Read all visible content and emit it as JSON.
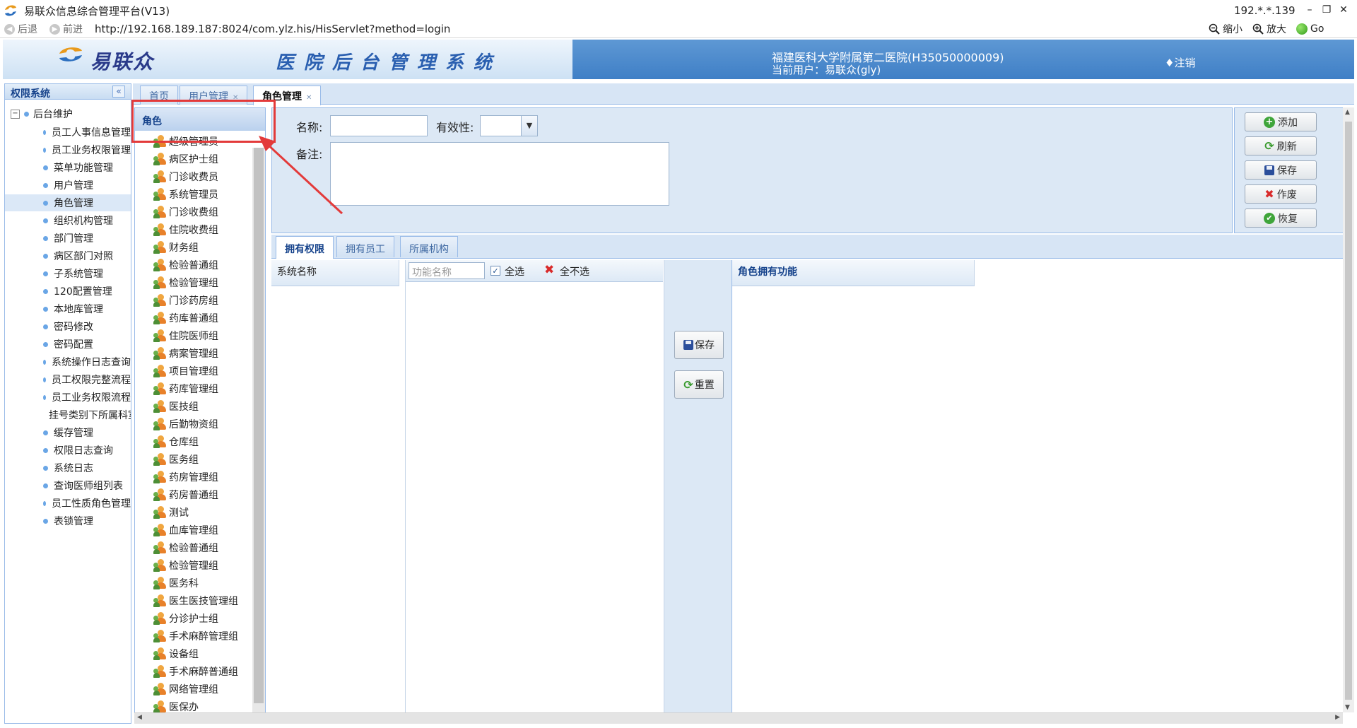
{
  "window": {
    "title": "易联众信息综合管理平台(V13)",
    "ip": "192.*.*.139",
    "minimize": "–",
    "restore": "❐",
    "close": "✕"
  },
  "addressbar": {
    "back": "后退",
    "forward": "前进",
    "url": "http://192.168.189.187:8024/com.ylz.his/HisServlet?method=login",
    "zoom_out": "缩小",
    "zoom_in": "放大",
    "go": "Go"
  },
  "header": {
    "brand": "易联众",
    "system_title": "医院后台管理系统",
    "hospital": "福建医科大学附属第二医院(H35050000009)",
    "current_user": "当前用户：易联众(gly)",
    "logout": "♦注销"
  },
  "sidebar": {
    "title": "权限系统",
    "collapse": "«",
    "root": "后台维护",
    "items": [
      {
        "label": "员工人事信息管理"
      },
      {
        "label": "员工业务权限管理"
      },
      {
        "label": "菜单功能管理"
      },
      {
        "label": "用户管理"
      },
      {
        "label": "角色管理",
        "selected": true
      },
      {
        "label": "组织机构管理"
      },
      {
        "label": "部门管理"
      },
      {
        "label": "病区部门对照"
      },
      {
        "label": "子系统管理"
      },
      {
        "label": "120配置管理"
      },
      {
        "label": "本地库管理"
      },
      {
        "label": "密码修改"
      },
      {
        "label": "密码配置"
      },
      {
        "label": "系统操作日志查询"
      },
      {
        "label": "员工权限完整流程"
      },
      {
        "label": "员工业务权限流程"
      },
      {
        "label": "挂号类别下所属科室"
      },
      {
        "label": "缓存管理"
      },
      {
        "label": "权限日志查询"
      },
      {
        "label": "系统日志"
      },
      {
        "label": "查询医师组列表"
      },
      {
        "label": "员工性质角色管理"
      },
      {
        "label": "表锁管理"
      }
    ]
  },
  "tabs": [
    {
      "label": "首页",
      "closable": false
    },
    {
      "label": "用户管理",
      "closable": true
    },
    {
      "label": "角色管理",
      "closable": true,
      "active": true
    }
  ],
  "roles": {
    "header": "角色",
    "items": [
      "超级管理员",
      "病区护士组",
      "门诊收费员",
      "系统管理员",
      "门诊收费组",
      "住院收费组",
      "财务组",
      "检验普通组",
      "检验管理组",
      "门诊药房组",
      "药库普通组",
      "住院医师组",
      "病案管理组",
      "项目管理组",
      "药库管理组",
      "医技组",
      "后勤物资组",
      "仓库组",
      "医务组",
      "药房管理组",
      "药房普通组",
      "测试",
      "血库管理组",
      "检验普通组",
      "检验管理组",
      "医务科",
      "医生医技管理组",
      "分诊护士组",
      "手术麻醉管理组",
      "设备组",
      "手术麻醉普通组",
      "网络管理组",
      "医保办"
    ]
  },
  "form": {
    "name_label": "名称:",
    "name_value": "",
    "valid_label": "有效性:",
    "valid_value": "",
    "remark_label": "备注:",
    "remark_value": ""
  },
  "actions": {
    "add": "添加",
    "refresh": "刷新",
    "save": "保存",
    "void": "作废",
    "restore": "恢复"
  },
  "subtabs": [
    {
      "label": "拥有权限",
      "active": true
    },
    {
      "label": "拥有员工"
    },
    {
      "label": "所属机构"
    }
  ],
  "permissions": {
    "system_col": "系统名称",
    "func_placeholder": "功能名称",
    "select_all": "全选",
    "select_all_checked": true,
    "deselect_all": "全不选",
    "save": "保存",
    "reset": "重置",
    "role_col": "角色拥有功能"
  },
  "colors": {
    "accent": "#15428b",
    "panel_bg": "#dce8f5",
    "border": "#99bbe8",
    "annotation": "#e33a3a"
  }
}
